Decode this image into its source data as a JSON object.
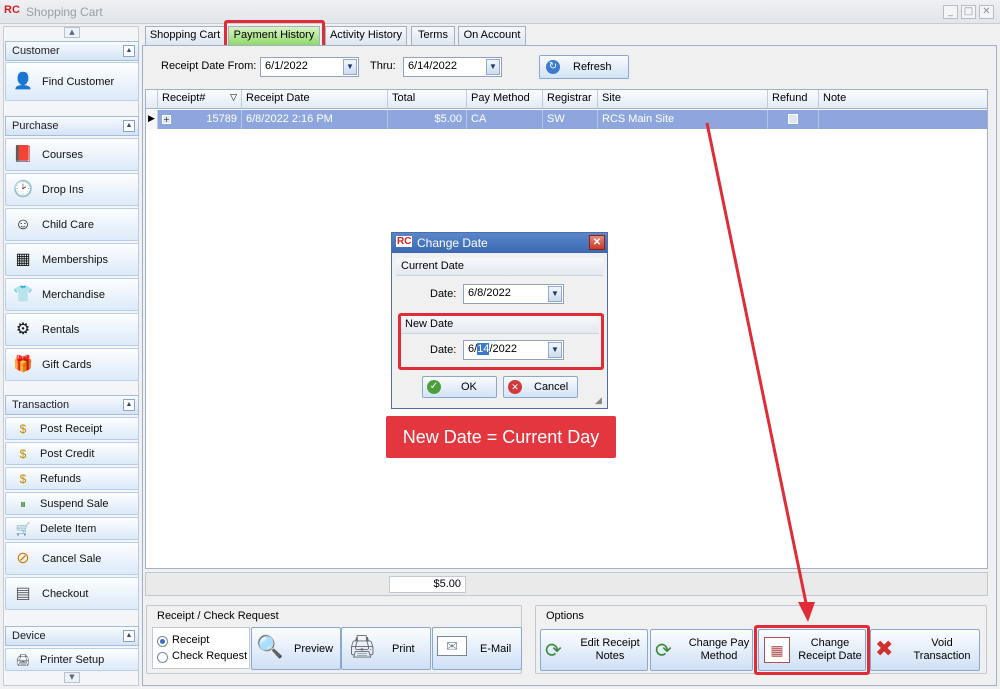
{
  "window": {
    "title": "Shopping Cart",
    "app_logo": "RC"
  },
  "sidebar": {
    "sections": [
      {
        "header": "Customer",
        "items": [
          {
            "label": "Find Customer",
            "icon": "person-search-icon"
          }
        ]
      },
      {
        "header": "Purchase",
        "items": [
          {
            "label": "Courses",
            "icon": "book-icon"
          },
          {
            "label": "Drop Ins",
            "icon": "clock-icon"
          },
          {
            "label": "Child Care",
            "icon": "child-icon"
          },
          {
            "label": "Memberships",
            "icon": "card-icon"
          },
          {
            "label": "Merchandise",
            "icon": "shirt-icon"
          },
          {
            "label": "Rentals",
            "icon": "rental-icon"
          },
          {
            "label": "Gift Cards",
            "icon": "gift-icon"
          }
        ]
      },
      {
        "header": "Transaction",
        "items": [
          {
            "label": "Post Receipt",
            "icon": "money-icon"
          },
          {
            "label": "Post Credit",
            "icon": "credit-icon"
          },
          {
            "label": "Refunds",
            "icon": "refund-icon"
          },
          {
            "label": "Suspend Sale",
            "icon": "pause-icon"
          },
          {
            "label": "Delete Item",
            "icon": "cart-delete-icon"
          },
          {
            "label": "Cancel Sale",
            "icon": "cancel-coins-icon"
          },
          {
            "label": "Checkout",
            "icon": "register-icon"
          }
        ]
      },
      {
        "header": "Device",
        "items": [
          {
            "label": "Printer Setup",
            "icon": "printer-icon"
          }
        ]
      }
    ]
  },
  "tabs": [
    {
      "label": "Shopping Cart",
      "active": false
    },
    {
      "label": "Payment History",
      "active": true
    },
    {
      "label": "Activity History",
      "active": false
    },
    {
      "label": "Terms",
      "active": false
    },
    {
      "label": "On Account",
      "active": false
    }
  ],
  "filter": {
    "from_label": "Receipt Date From:",
    "from_value": "6/1/2022",
    "thru_label": "Thru:",
    "thru_value": "6/14/2022",
    "refresh_label": "Refresh"
  },
  "grid": {
    "columns": [
      "Receipt#",
      "Receipt Date",
      "Total",
      "Pay Method",
      "Registrar",
      "Site",
      "Refund",
      "Note"
    ],
    "rows": [
      {
        "receipt": "15789",
        "date": "6/8/2022 2:16 PM",
        "total": "$5.00",
        "pay_method": "CA",
        "registrar": "SW",
        "site": "RCS Main Site",
        "refund": false,
        "note": ""
      }
    ],
    "footer_total": "$5.00"
  },
  "receipt_group": {
    "title": "Receipt / Check Request",
    "radio_receipt": "Receipt",
    "radio_check": "Check Request",
    "selected": "Receipt",
    "preview_label": "Preview",
    "print_label": "Print",
    "email_label": "E-Mail"
  },
  "options_group": {
    "title": "Options",
    "edit_notes_label": "Edit Receipt Notes",
    "change_pay_label": "Change Pay Method",
    "change_date_label": "Change Receipt Date",
    "void_label": "Void Transaction"
  },
  "dialog": {
    "title": "Change Date",
    "current_section": "Current Date",
    "current_date_label": "Date:",
    "current_date_value": "6/8/2022",
    "new_section": "New Date",
    "new_date_label": "Date:",
    "new_date_prefix": "6/",
    "new_date_selected": "14",
    "new_date_suffix": "/2022",
    "ok_label": "OK",
    "cancel_label": "Cancel"
  },
  "annotation": {
    "text": "New Date = Current Day",
    "color": "#e4363e"
  }
}
